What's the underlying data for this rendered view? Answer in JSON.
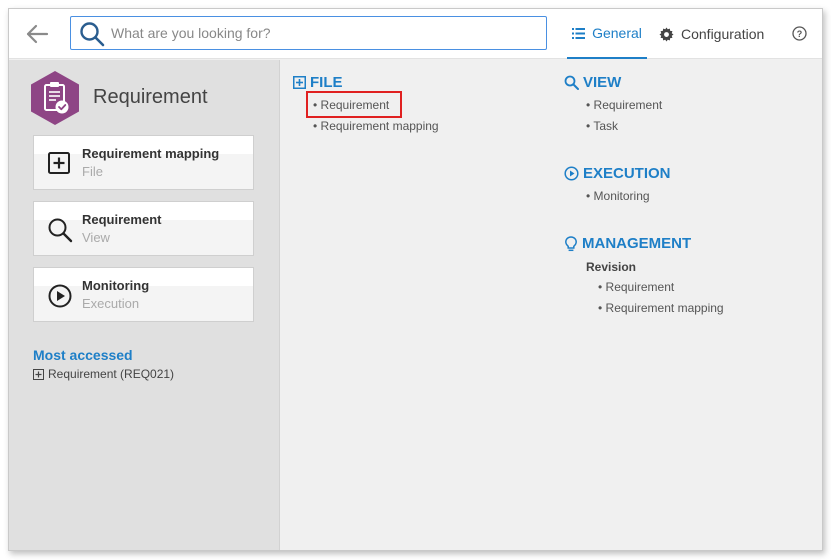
{
  "header": {
    "search_placeholder": "What are you looking for?",
    "tabs": [
      {
        "label": "General",
        "active": true
      },
      {
        "label": "Configuration",
        "active": false
      }
    ]
  },
  "sidebar": {
    "module_title": "Requirement",
    "module_icon_color": "#8e4585",
    "cards": [
      {
        "title": "Requirement mapping",
        "subtitle": "File",
        "icon": "plus-square-icon"
      },
      {
        "title": "Requirement",
        "subtitle": "View",
        "icon": "search-icon"
      },
      {
        "title": "Monitoring",
        "subtitle": "Execution",
        "icon": "play-circle-icon"
      }
    ],
    "most_accessed_label": "Most accessed",
    "most_accessed_items": [
      "Requirement (REQ021)"
    ]
  },
  "main": {
    "file": {
      "title": "FILE",
      "items": [
        "• Requirement",
        "• Requirement mapping"
      ]
    },
    "view": {
      "title": "VIEW",
      "items": [
        "• Requirement",
        "• Task"
      ]
    },
    "execution": {
      "title": "EXECUTION",
      "items": [
        "• Monitoring"
      ]
    },
    "management": {
      "title": "MANAGEMENT",
      "subheading": "Revision",
      "items": [
        "• Requirement",
        "• Requirement mapping"
      ]
    }
  },
  "colors": {
    "accent": "#1e7fc7",
    "highlight": "#e02020"
  }
}
